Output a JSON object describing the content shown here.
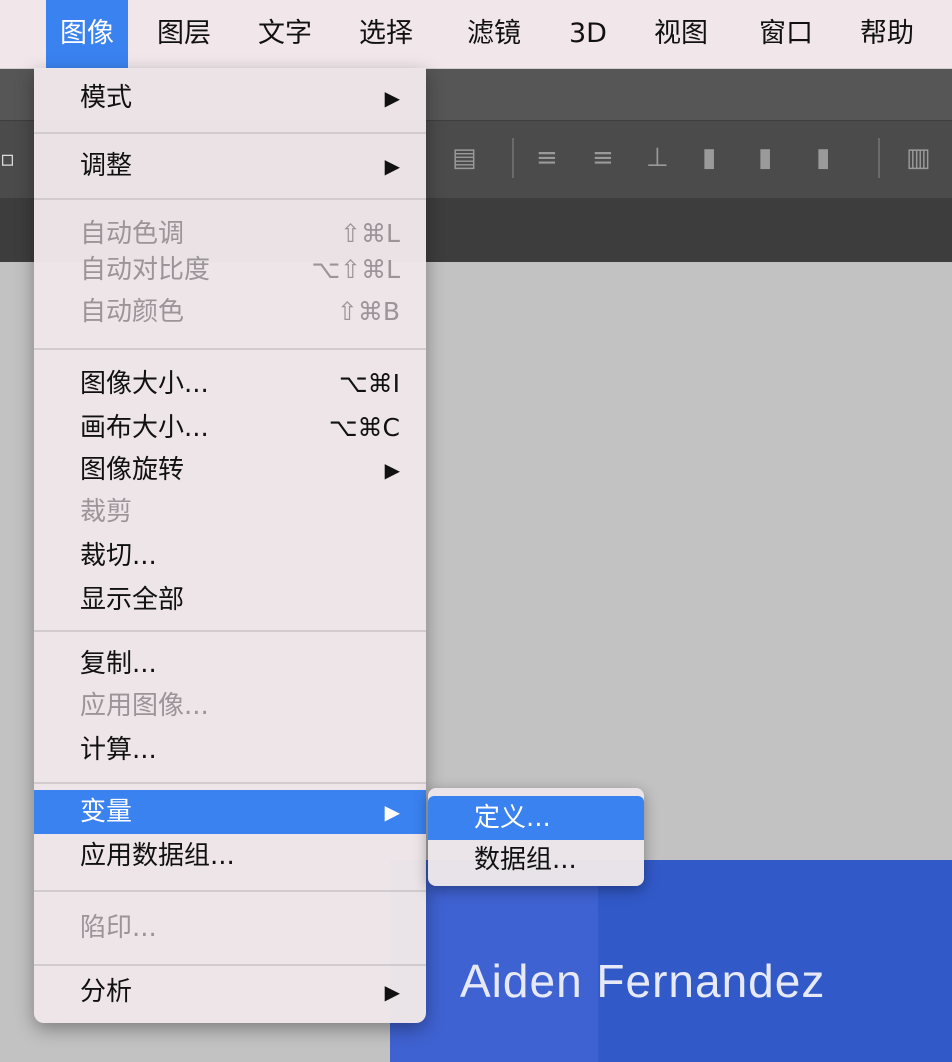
{
  "menubar": {
    "items": [
      "图像",
      "图层",
      "文字",
      "选择",
      "滤镜",
      "3D",
      "视图",
      "窗口",
      "帮助"
    ]
  },
  "menu": {
    "sections": [
      [
        {
          "label": "模式",
          "submenu": true
        },
        {
          "label": "调整",
          "submenu": true
        }
      ],
      [
        {
          "label": "自动色调",
          "shortcut": "⇧⌘L",
          "disabled": true
        },
        {
          "label": "自动对比度",
          "shortcut": "⌥⇧⌘L",
          "disabled": true
        },
        {
          "label": "自动颜色",
          "shortcut": "⇧⌘B",
          "disabled": true
        }
      ],
      [
        {
          "label": "图像大小...",
          "shortcut": "⌥⌘I"
        },
        {
          "label": "画布大小...",
          "shortcut": "⌥⌘C"
        },
        {
          "label": "图像旋转",
          "submenu": true
        },
        {
          "label": "裁剪",
          "disabled": true
        },
        {
          "label": "裁切..."
        },
        {
          "label": "显示全部"
        }
      ],
      [
        {
          "label": "复制..."
        },
        {
          "label": "应用图像...",
          "disabled": true
        },
        {
          "label": "计算..."
        }
      ],
      [
        {
          "label": "变量",
          "submenu": true,
          "selected": true
        },
        {
          "label": "应用数据组..."
        }
      ],
      [
        {
          "label": "陷印...",
          "disabled": true
        }
      ],
      [
        {
          "label": "分析",
          "submenu": true
        }
      ]
    ],
    "mode": "模式",
    "adjust": "调整",
    "auto_tone": "自动色调",
    "auto_tone_sc": "⇧⌘L",
    "auto_contrast": "自动对比度",
    "auto_contrast_sc": "⌥⇧⌘L",
    "auto_color": "自动颜色",
    "auto_color_sc": "⇧⌘B",
    "image_size": "图像大小...",
    "image_size_sc": "⌥⌘I",
    "canvas_size": "画布大小...",
    "canvas_size_sc": "⌥⌘C",
    "image_rotation": "图像旋转",
    "crop": "裁剪",
    "trim": "裁切...",
    "reveal_all": "显示全部",
    "duplicate": "复制...",
    "apply_image": "应用图像...",
    "calculations": "计算...",
    "variables": "变量",
    "apply_data_set": "应用数据组...",
    "trap": "陷印...",
    "analysis": "分析",
    "arrow": "▶"
  },
  "submenu": {
    "define": "定义...",
    "data_sets": "数据组..."
  },
  "canvas": {
    "name_text": "Aiden Fernandez"
  },
  "colors": {
    "accent": "#3a82f0",
    "card_blue": "#3f62d2"
  }
}
